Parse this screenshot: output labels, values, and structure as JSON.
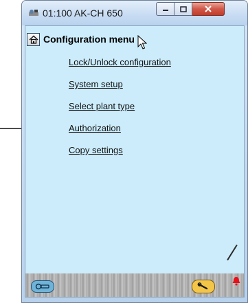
{
  "window": {
    "title": "01:100 AK-CH 650"
  },
  "page": {
    "title": "Configuration menu"
  },
  "menu": {
    "items": [
      {
        "label": "Lock/Unlock configuration"
      },
      {
        "label": "System setup"
      },
      {
        "label": "Select plant type"
      },
      {
        "label": "Authorization"
      },
      {
        "label": "Copy settings"
      }
    ]
  },
  "icons": {
    "app": "plant-icon",
    "home": "home-icon",
    "status_left": "login-icon",
    "status_right": "wrench-icon",
    "alarm": "alarm-bell-icon"
  },
  "colors": {
    "client_background": "#ccecfb",
    "close_button": "#c23a28",
    "alarm": "#e8101a"
  }
}
